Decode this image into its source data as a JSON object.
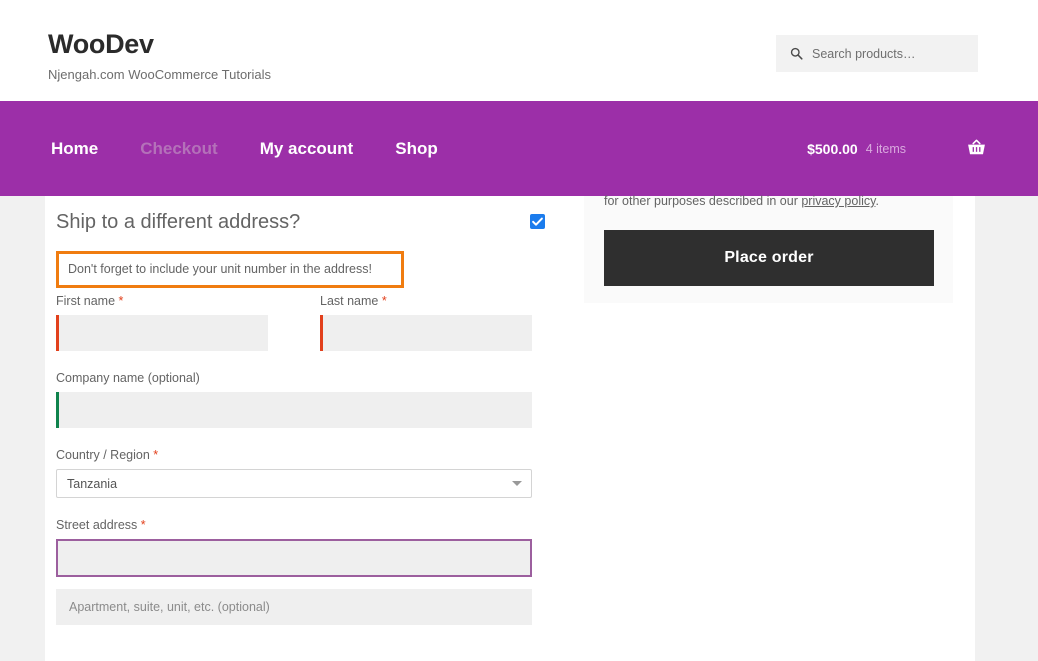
{
  "header": {
    "site_title": "WooDev",
    "tagline": "Njengah.com WooCommerce Tutorials",
    "search": {
      "placeholder": "Search products…",
      "icon": "search-icon"
    }
  },
  "nav": {
    "items": [
      {
        "label": "Home",
        "current": false
      },
      {
        "label": "Checkout",
        "current": true
      },
      {
        "label": "My account",
        "current": false
      },
      {
        "label": "Shop",
        "current": false
      }
    ],
    "cart": {
      "total": "$500.00",
      "count": "4 items",
      "icon": "shopping-basket-icon"
    },
    "background_color": "#9c2fa8"
  },
  "checkout": {
    "heading": "Ship to a different address?",
    "ship_toggle_checked": true,
    "ship_toggle_color": "#1b7ced",
    "notice": {
      "text": "Don't forget to include your unit number in the address!",
      "border_color": "#f07c10"
    },
    "fields": {
      "first_name": {
        "label": "First name",
        "required": true,
        "value": "",
        "placeholder": "",
        "accent_color": "#e2401c"
      },
      "last_name": {
        "label": "Last name",
        "required": true,
        "value": "",
        "placeholder": "",
        "accent_color": "#e2401c"
      },
      "company_name": {
        "label": "Company name (optional)",
        "required": false,
        "value": "",
        "placeholder": "",
        "accent_color": "#0f834d"
      },
      "country": {
        "label": "Country / Region",
        "required": true,
        "selected": "Tanzania"
      },
      "street_address": {
        "label": "Street address",
        "required": true,
        "value": "",
        "placeholder": "",
        "focused": true,
        "focus_border_color": "#9c5f9e"
      },
      "address_line_2": {
        "label": "",
        "required": false,
        "value": "",
        "placeholder": "Apartment, suite, unit, etc. (optional)"
      }
    },
    "required_marker": "*"
  },
  "order_review": {
    "privacy_text_prefix": "for other purposes described in our ",
    "privacy_link": "privacy policy",
    "privacy_text_suffix": ".",
    "place_order_label": "Place order",
    "place_order_color": "#2f2f2f"
  }
}
